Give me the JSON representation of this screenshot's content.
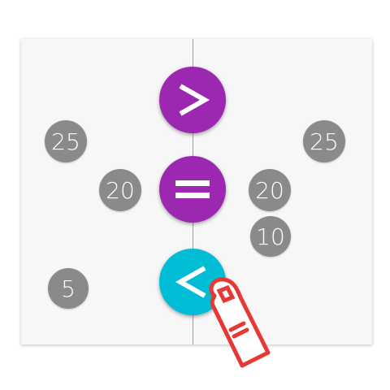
{
  "left_numbers": [
    {
      "value": "25",
      "bubble_color": "#8a8a8a"
    },
    {
      "value": "20",
      "bubble_color": "#8a8a8a"
    },
    {
      "value": "5",
      "bubble_color": "#8a8a8a"
    }
  ],
  "right_numbers": [
    {
      "value": "25",
      "bubble_color": "#8a8a8a"
    },
    {
      "value": "20",
      "bubble_color": "#8a8a8a"
    },
    {
      "value": "10",
      "bubble_color": "#8a8a8a"
    }
  ],
  "operator_buttons": [
    {
      "symbol": ">",
      "icon": "greater-than-icon",
      "color": "#9c27b0"
    },
    {
      "symbol": "=",
      "icon": "equals-icon",
      "color": "#9c27b0"
    },
    {
      "symbol": "<",
      "icon": "less-than-icon",
      "color": "#00bcd4"
    }
  ],
  "tap_hint": {
    "icon": "pointing-finger-icon",
    "color": "#e53935"
  }
}
